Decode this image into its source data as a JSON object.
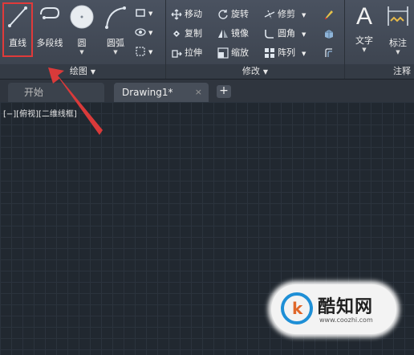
{
  "ribbon": {
    "draw_panel": {
      "line_label": "直线",
      "polyline_label": "多段线",
      "circle_label": "圆",
      "arc_label": "圆弧",
      "footer": "绘图"
    },
    "modify_panel": {
      "move": "移动",
      "rotate": "旋转",
      "trim": "修剪",
      "copy": "复制",
      "mirror": "镜像",
      "fillet": "圆角",
      "stretch": "拉伸",
      "scale": "缩放",
      "array": "阵列",
      "footer": "修改"
    },
    "annotation_panel": {
      "text_label": "文字",
      "dim_label": "标注",
      "footer": "注释"
    }
  },
  "tabs": {
    "start": "开始",
    "active": "Drawing1*",
    "close": "×",
    "new": "+"
  },
  "viewport": {
    "label": "[−][俯视][二维线框]"
  },
  "watermark": {
    "logo_char": "k",
    "name": "酷知网",
    "url": "www.coozhi.com"
  },
  "colors": {
    "highlight": "#e03a3a",
    "canvas": "#212830",
    "ribbon": "#3f4651"
  }
}
